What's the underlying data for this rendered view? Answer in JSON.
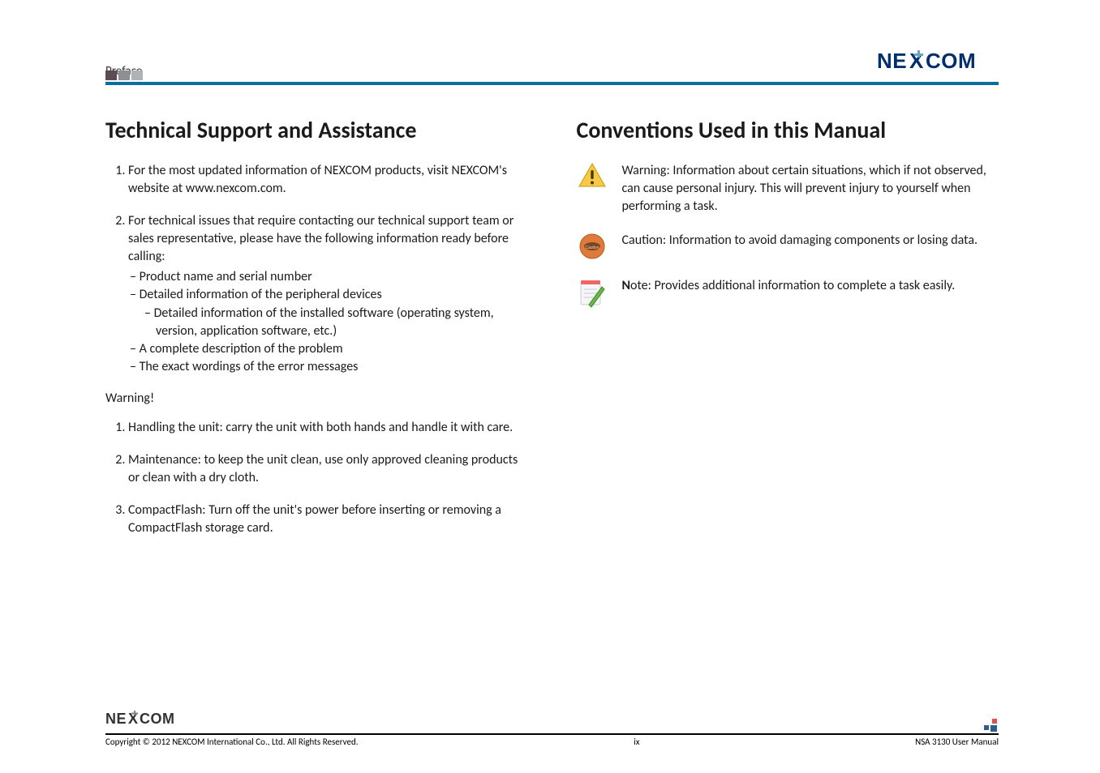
{
  "header": {
    "section_label": "Preface",
    "brand": "NEXCOM"
  },
  "left": {
    "title": "Technical Support and Assistance",
    "items": [
      {
        "text": "For the most updated information of NEXCOM products, visit NEXCOM's website at www.nexcom.com."
      },
      {
        "text": "For technical issues that require contacting our technical support team or sales representative, please have the following information ready before calling:",
        "subitems": [
          "– Product name and serial number",
          "– Detailed information of the peripheral devices",
          "– Detailed information of the installed software (operating system, version, application software, etc.)",
          "– A complete description of the problem",
          "– The exact wordings of the error messages"
        ]
      }
    ],
    "warning_head": "Warning!",
    "warnings": [
      "Handling the unit: carry the unit with both hands and handle it with care.",
      "Maintenance: to keep the unit clean, use only approved cleaning products or clean with a dry cloth.",
      "CompactFlash: Turn off the unit's power before inserting or removing a CompactFlash storage card."
    ]
  },
  "right": {
    "title": "Conventions Used in this Manual",
    "conventions": [
      {
        "icon": "warning-triangle-icon",
        "text": "Warning: Information about certain situations, which if not observed, can cause personal injury. This will prevent injury to yourself when performing a task."
      },
      {
        "icon": "caution-diamond-icon",
        "text": "Caution: Information to avoid damaging components or losing data."
      },
      {
        "icon": "note-pencil-icon",
        "lead_bold": "N",
        "text_rest": "ote: Provides additional information to complete a task easily."
      }
    ]
  },
  "footer": {
    "brand": "NEXCOM",
    "copyright": "Copyright © 2012 NEXCOM International Co., Ltd. All Rights Reserved.",
    "page_num": "ix",
    "doc_title": "NSA 3130 User Manual"
  }
}
